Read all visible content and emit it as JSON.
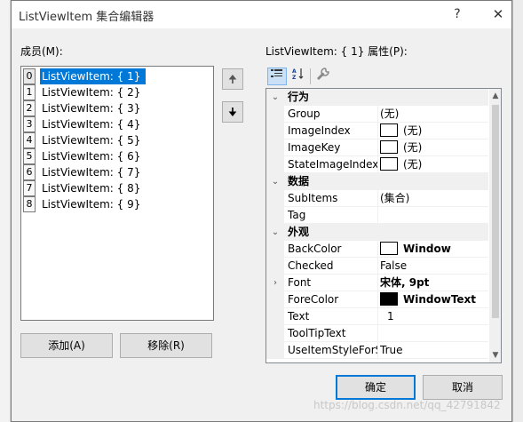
{
  "dialog": {
    "title": "ListViewItem 集合编辑器",
    "help_label": "?",
    "close_label": "✕"
  },
  "members": {
    "label": "成员(M):",
    "items": [
      {
        "index": "0",
        "text": "ListViewItem: {  1}",
        "selected": true
      },
      {
        "index": "1",
        "text": "ListViewItem: {  2}",
        "selected": false
      },
      {
        "index": "2",
        "text": "ListViewItem: {  3}",
        "selected": false
      },
      {
        "index": "3",
        "text": "ListViewItem: {  4}",
        "selected": false
      },
      {
        "index": "4",
        "text": "ListViewItem: {  5}",
        "selected": false
      },
      {
        "index": "5",
        "text": "ListViewItem: {  6}",
        "selected": false
      },
      {
        "index": "6",
        "text": "ListViewItem: {  7}",
        "selected": false
      },
      {
        "index": "7",
        "text": "ListViewItem: {  8}",
        "selected": false
      },
      {
        "index": "8",
        "text": "ListViewItem: {  9}",
        "selected": false
      }
    ],
    "move_up_icon": "up-arrow-icon",
    "move_down_icon": "down-arrow-icon",
    "up_glyph": "🠉",
    "down_glyph": "🠋",
    "add_label": "添加(A)",
    "remove_label": "移除(R)"
  },
  "properties": {
    "label": "ListViewItem: {  1} 属性(P):",
    "toolbar": {
      "categorized_icon": "categorized-icon",
      "alphabetical_icon": "alphabetical-icon",
      "property_pages_icon": "wrench-icon"
    },
    "rows": [
      {
        "type": "category",
        "name": "行为",
        "expander": "⌄"
      },
      {
        "type": "prop",
        "name": "Group",
        "value": "(无)"
      },
      {
        "type": "prop",
        "name": "ImageIndex",
        "value": "(无)",
        "swatch": "#ffffff"
      },
      {
        "type": "prop",
        "name": "ImageKey",
        "value": "(无)",
        "swatch": "#ffffff"
      },
      {
        "type": "prop",
        "name": "StateImageIndex",
        "value": "(无)",
        "swatch": "#ffffff"
      },
      {
        "type": "category",
        "name": "数据",
        "expander": "⌄"
      },
      {
        "type": "prop",
        "name": "SubItems",
        "value": "(集合)"
      },
      {
        "type": "prop",
        "name": "Tag",
        "value": ""
      },
      {
        "type": "category",
        "name": "外观",
        "expander": "⌄"
      },
      {
        "type": "prop",
        "name": "BackColor",
        "value": "Window",
        "swatch": "#ffffff",
        "bold_value": true
      },
      {
        "type": "prop",
        "name": "Checked",
        "value": "False"
      },
      {
        "type": "prop",
        "name": "Font",
        "value": "宋体, 9pt",
        "bold_value": true,
        "expander": "›"
      },
      {
        "type": "prop",
        "name": "ForeColor",
        "value": "WindowText",
        "swatch": "#000000",
        "bold_value": true
      },
      {
        "type": "prop",
        "name": "Text",
        "value": "1",
        "editing": true
      },
      {
        "type": "prop",
        "name": "ToolTipText",
        "value": ""
      },
      {
        "type": "prop",
        "name": "UseItemStyleForSubItems",
        "value": "True"
      }
    ]
  },
  "footer": {
    "ok_label": "确定",
    "cancel_label": "取消"
  },
  "watermark": "https://blog.csdn.net/qq_42791842"
}
